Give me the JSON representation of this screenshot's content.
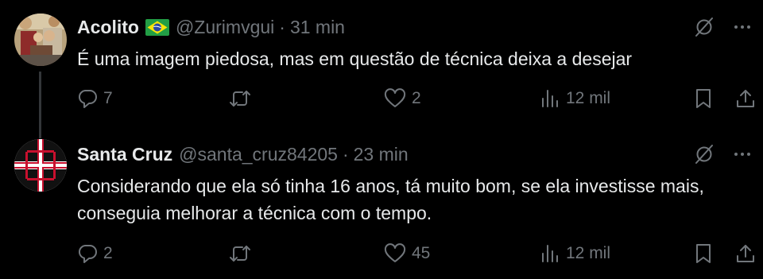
{
  "tweets": [
    {
      "name": "Acolito",
      "handle": "@Zurimvgui",
      "separator": "·",
      "time": "31 min",
      "flag": "brazil-flag",
      "text": "É uma imagem piedosa, mas em questão de técnica deixa a desejar",
      "replies": "7",
      "retweets": "",
      "likes": "2",
      "views": "12 mil"
    },
    {
      "name": "Santa Cruz",
      "handle": "@santa_cruz84205",
      "separator": "·",
      "time": "23 min",
      "text": "Considerando que ela só tinha 16 anos, tá muito bom, se ela investisse mais, conseguia melhorar a técnica com o tempo.",
      "replies": "2",
      "retweets": "",
      "likes": "45",
      "views": "12 mil"
    }
  ],
  "icons": {
    "reply": "reply-icon",
    "retweet": "retweet-icon",
    "like": "heart-icon",
    "views": "views-icon",
    "bookmark": "bookmark-icon",
    "share": "share-icon",
    "grok": "grok-icon",
    "more": "more-icon"
  },
  "colors": {
    "background": "#000000",
    "text": "#e7e9ea",
    "secondary": "#71767b",
    "thread_line": "#333639"
  }
}
